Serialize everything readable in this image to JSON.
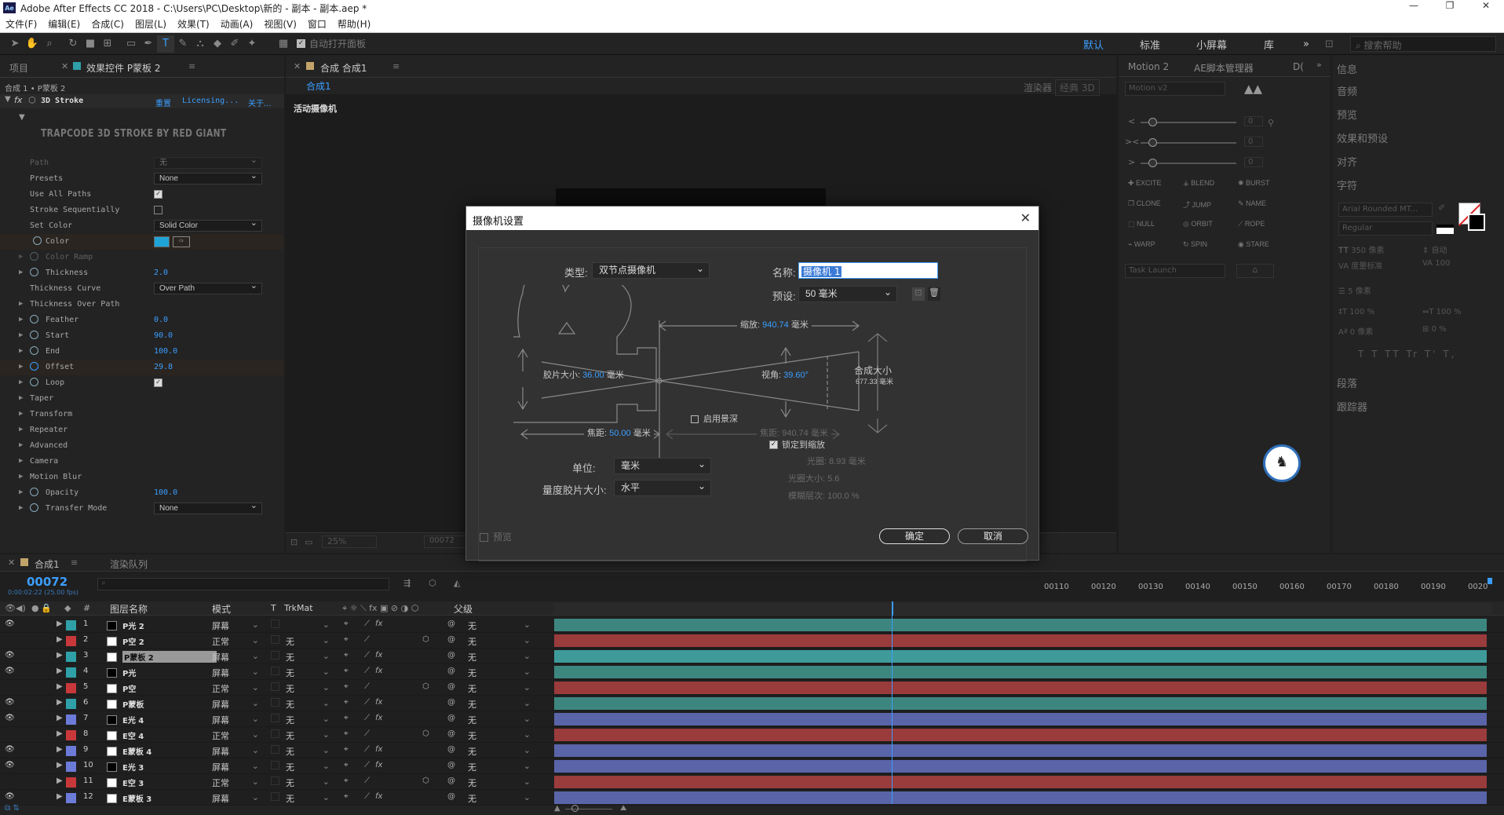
{
  "titlebar": {
    "app_badge": "Ae",
    "title": "Adobe After Effects CC 2018 - C:\\Users\\PC\\Desktop\\新的 - 副本 - 副本.aep *",
    "minimize": "—",
    "maximize": "❐",
    "close": "✕"
  },
  "menu": [
    "文件(F)",
    "编辑(E)",
    "合成(C)",
    "图层(L)",
    "效果(T)",
    "动画(A)",
    "视图(V)",
    "窗口",
    "帮助(H)"
  ],
  "toolbar": {
    "auto_open": "自动打开面板",
    "workspaces": [
      "默认",
      "标准",
      "小屏幕",
      "库"
    ],
    "more": "»",
    "search_placeholder": "搜索帮助"
  },
  "left_panel": {
    "tab_project": "项目",
    "tab_effects": "效果控件 P蒙板 2",
    "breadcrumb": "合成 1 • P蒙板 2",
    "effect_name": "3D Stroke",
    "reset": "重置",
    "licensing": "Licensing...",
    "about": "关于...",
    "banner": "TRAPCODE 3D STROKE BY RED GIANT",
    "path": {
      "label": "Path",
      "value": "无"
    },
    "presets": {
      "label": "Presets",
      "value": "None"
    },
    "use_all_paths": "Use All Paths",
    "stroke_seq": "Stroke Sequentially",
    "set_color": {
      "label": "Set Color",
      "value": "Solid Color"
    },
    "color": {
      "label": "Color",
      "swatch": "#1fa3d6"
    },
    "color_ramp": "Color Ramp",
    "thickness": {
      "label": "Thickness",
      "value": "2.0"
    },
    "thickness_curve": {
      "label": "Thickness Curve",
      "value": "Over Path"
    },
    "thickness_over_path": "Thickness Over Path",
    "feather": {
      "label": "Feather",
      "value": "0.0"
    },
    "start": {
      "label": "Start",
      "value": "90.0"
    },
    "end": {
      "label": "End",
      "value": "100.0"
    },
    "offset": {
      "label": "Offset",
      "value": "29.8"
    },
    "loop": "Loop",
    "groups": [
      "Taper",
      "Transform",
      "Repeater",
      "Advanced",
      "Camera",
      "Motion Blur"
    ],
    "opacity": {
      "label": "Opacity",
      "value": "100.0"
    },
    "transfer_mode": {
      "label": "Transfer Mode",
      "value": "None"
    }
  },
  "comp_panel": {
    "tab": "合成 合成1",
    "sub_tab": "合成1",
    "active_camera": "活动摄像机",
    "renderer_label": "渲染器",
    "renderer": "经典 3D",
    "zoom": "25%",
    "timecode": "00072"
  },
  "motion_panel": {
    "tab1": "Motion 2",
    "tab2": "AE脚本管理器",
    "tab3": "D(",
    "version": "Motion v2",
    "sliders": [
      {
        "label": "<",
        "value": "0"
      },
      {
        "label": "><",
        "value": "0"
      },
      {
        "label": ">",
        "value": "0"
      }
    ],
    "buttons": [
      "EXCITE",
      "BLEND",
      "BURST",
      "CLONE",
      "JUMP",
      "NAME",
      "NULL",
      "ORBIT",
      "ROPE",
      "WARP",
      "SPIN",
      "STARE"
    ],
    "task": "Task Launch"
  },
  "right_panel": {
    "items": [
      "信息",
      "音频",
      "预览",
      "效果和预设",
      "对齐",
      "字符"
    ],
    "font": "Arial Rounded MT...",
    "style": "Regular",
    "size": "350 像素",
    "leading": "自动",
    "tracking_label": "度量标准",
    "tracking": "100",
    "stroke": "5 像素",
    "vscale": "100 %",
    "hscale": "100 %",
    "baseline": "0 像素",
    "tsume": "0 %",
    "styles": "T T TT Tr T' T,",
    "items2": [
      "段落",
      "跟踪器"
    ]
  },
  "dialog": {
    "title": "摄像机设置",
    "close": "✕",
    "type_label": "类型:",
    "type_value": "双节点摄像机",
    "name_label": "名称:",
    "name_value": "摄像机 1",
    "preset_label": "预设:",
    "preset_value": "50 毫米",
    "zoom_label": "缩放:",
    "zoom_value": "940.74",
    "zoom_unit": "毫米",
    "film_label": "胶片大小:",
    "film_value": "36.00",
    "film_unit": "毫米",
    "aov_label": "视角:",
    "aov_value": "39.60",
    "aov_unit": "°",
    "comp_label": "合成大小",
    "comp_value": "677.33",
    "comp_unit": "毫米",
    "dof_label": "启用景深",
    "focal_label": "焦距:",
    "focal_value": "50.00",
    "focal_unit": "毫米",
    "focus_label": "焦距:",
    "focus_value": "940.74",
    "focus_unit": "毫米",
    "lock_label": "锁定到缩放",
    "aperture_label": "光圈:",
    "aperture_value": "8.93",
    "aperture_unit": "毫米",
    "fstop_label": "光圈大小:",
    "fstop_value": "5.6",
    "blur_label": "模糊层次:",
    "blur_value": "100.0",
    "blur_unit": "%",
    "units_label": "单位:",
    "units_value": "毫米",
    "measure_label": "量度胶片大小:",
    "measure_value": "水平",
    "preview": "预览",
    "ok": "确定",
    "cancel": "取消"
  },
  "timeline": {
    "tab": "合成1",
    "tab2": "渲染队列",
    "timecode": "00072",
    "subtime": "0:00:02:22 (25.00 fps)",
    "headers": {
      "num": "#",
      "name": "图层名称",
      "mode": "模式",
      "t": "T",
      "trkmat": "TrkMat",
      "parent": "父级"
    },
    "ruler": [
      "00110",
      "00120",
      "00130",
      "00140",
      "00150",
      "00160",
      "00170",
      "00180",
      "00190",
      "0020"
    ],
    "layers": [
      {
        "num": "1",
        "name": "P光 2",
        "mode": "屏幕",
        "trk": "",
        "parent": "无",
        "color": "#2fa0a8",
        "bar": "#3d8680",
        "icon": "#000",
        "vis": true
      },
      {
        "num": "2",
        "name": "P空 2",
        "mode": "正常",
        "trk": "无",
        "parent": "无",
        "color": "#c8383a",
        "bar": "#9a3b3c",
        "icon": "#fff",
        "vis": false
      },
      {
        "num": "3",
        "name": "P蒙板 2",
        "mode": "屏幕",
        "trk": "无",
        "parent": "无",
        "color": "#2fa0a8",
        "bar": "#3f9a9a",
        "icon": "#fff",
        "vis": true,
        "sel": true
      },
      {
        "num": "4",
        "name": "P光",
        "mode": "屏幕",
        "trk": "无",
        "parent": "无",
        "color": "#2fa0a8",
        "bar": "#3d8680",
        "icon": "#000",
        "vis": true
      },
      {
        "num": "5",
        "name": "P空",
        "mode": "正常",
        "trk": "无",
        "parent": "无",
        "color": "#c8383a",
        "bar": "#9a3b3c",
        "icon": "#fff",
        "vis": false
      },
      {
        "num": "6",
        "name": "P蒙板",
        "mode": "屏幕",
        "trk": "无",
        "parent": "无",
        "color": "#2fa0a8",
        "bar": "#3d8680",
        "icon": "#fff",
        "vis": true
      },
      {
        "num": "7",
        "name": "E光 4",
        "mode": "屏幕",
        "trk": "无",
        "parent": "无",
        "color": "#6c7ad8",
        "bar": "#5a64a8",
        "icon": "#000",
        "vis": true
      },
      {
        "num": "8",
        "name": "E空 4",
        "mode": "正常",
        "trk": "无",
        "parent": "无",
        "color": "#c8383a",
        "bar": "#9a3b3c",
        "icon": "#fff",
        "vis": false
      },
      {
        "num": "9",
        "name": "E蒙板 4",
        "mode": "屏幕",
        "trk": "无",
        "parent": "无",
        "color": "#6c7ad8",
        "bar": "#5a64a8",
        "icon": "#fff",
        "vis": true
      },
      {
        "num": "10",
        "name": "E光 3",
        "mode": "屏幕",
        "trk": "无",
        "parent": "无",
        "color": "#6c7ad8",
        "bar": "#5a64a8",
        "icon": "#000",
        "vis": true
      },
      {
        "num": "11",
        "name": "E空 3",
        "mode": "正常",
        "trk": "无",
        "parent": "无",
        "color": "#c8383a",
        "bar": "#9a3b3c",
        "icon": "#fff",
        "vis": false
      },
      {
        "num": "12",
        "name": "E蒙板 3",
        "mode": "屏幕",
        "trk": "无",
        "parent": "无",
        "color": "#6c7ad8",
        "bar": "#5a64a8",
        "icon": "#fff",
        "vis": true
      }
    ]
  }
}
